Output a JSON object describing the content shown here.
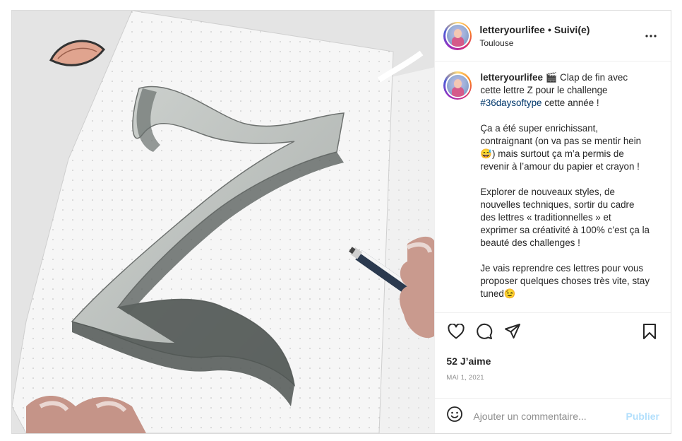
{
  "post": {
    "username": "letteryourlifee",
    "follow_status": "Suivi(e)",
    "separator": "•",
    "location": "Toulouse",
    "image_alt": "Hand-drawn 3D letter Z sketched in pencil in a dotted notebook",
    "caption": {
      "username": "letteryourlifee",
      "part1": " 🎬 Clap de fin avec cette lettre Z pour le challenge ",
      "hashtag": "#36daysoftype",
      "part2": " cette année !\n\nÇa a été super enrichissant, contraignant (on va pas se mentir hein 😅) mais surtout ça m’a permis de revenir à l’amour du papier et crayon !\n\nExplorer de nouveaux styles, de nouvelles techniques, sortir du cadre des lettres « traditionnelles » et exprimer sa créativité à 100% c’est ça la beauté des challenges !\n\nJe vais reprendre ces lettres pour vous proposer quelques choses très vite, stay tuned😉"
    },
    "likes": "52 J’aime",
    "date": "MAI 1, 2021",
    "comment_placeholder": "Ajouter un commentaire...",
    "publish_label": "Publier",
    "colors": {
      "hashtag": "#00376b",
      "publish_disabled": "#b2dffc",
      "border": "#dbdbdb"
    }
  }
}
